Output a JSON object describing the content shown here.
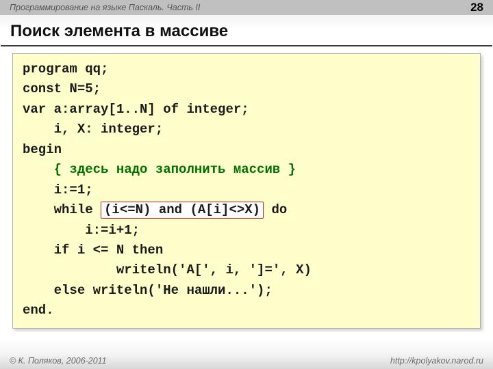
{
  "header": {
    "course": "Программирование на языке Паскаль. Часть II",
    "page": "28"
  },
  "title": "Поиск элемента в массиве",
  "code": {
    "lines": [
      {
        "indent": 0,
        "segments": [
          {
            "text": "program qq;"
          }
        ]
      },
      {
        "indent": 0,
        "segments": [
          {
            "text": "const N=5;"
          }
        ]
      },
      {
        "indent": 0,
        "segments": [
          {
            "text": "var a:array[1..N] of integer;"
          }
        ]
      },
      {
        "indent": 1,
        "segments": [
          {
            "text": "i, X: integer;"
          }
        ]
      },
      {
        "indent": 0,
        "segments": [
          {
            "text": "begin"
          }
        ]
      },
      {
        "indent": 1,
        "segments": [
          {
            "type": "cmt",
            "text": "{ здесь надо заполнить массив }"
          }
        ]
      },
      {
        "indent": 1,
        "segments": [
          {
            "text": "i:=1;"
          }
        ]
      },
      {
        "indent": 1,
        "segments": [
          {
            "text": "while "
          },
          {
            "type": "hl",
            "text": "(i<=N) and (A[i]<>X)"
          },
          {
            "text": " do"
          }
        ]
      },
      {
        "indent": 2,
        "segments": [
          {
            "text": "i:=i+1;"
          }
        ]
      },
      {
        "indent": 1,
        "segments": [
          {
            "text": "if i <= N then"
          }
        ]
      },
      {
        "indent": 3,
        "segments": [
          {
            "text": "writeln('A[', i, ']=', X)"
          }
        ]
      },
      {
        "indent": 1,
        "segments": [
          {
            "text": "else writeln('Не нашли...');"
          }
        ]
      },
      {
        "indent": 0,
        "segments": [
          {
            "text": "end."
          }
        ]
      }
    ]
  },
  "footer": {
    "copyright": "© К. Поляков, 2006-2011",
    "url": "http://kpolyakov.narod.ru"
  }
}
